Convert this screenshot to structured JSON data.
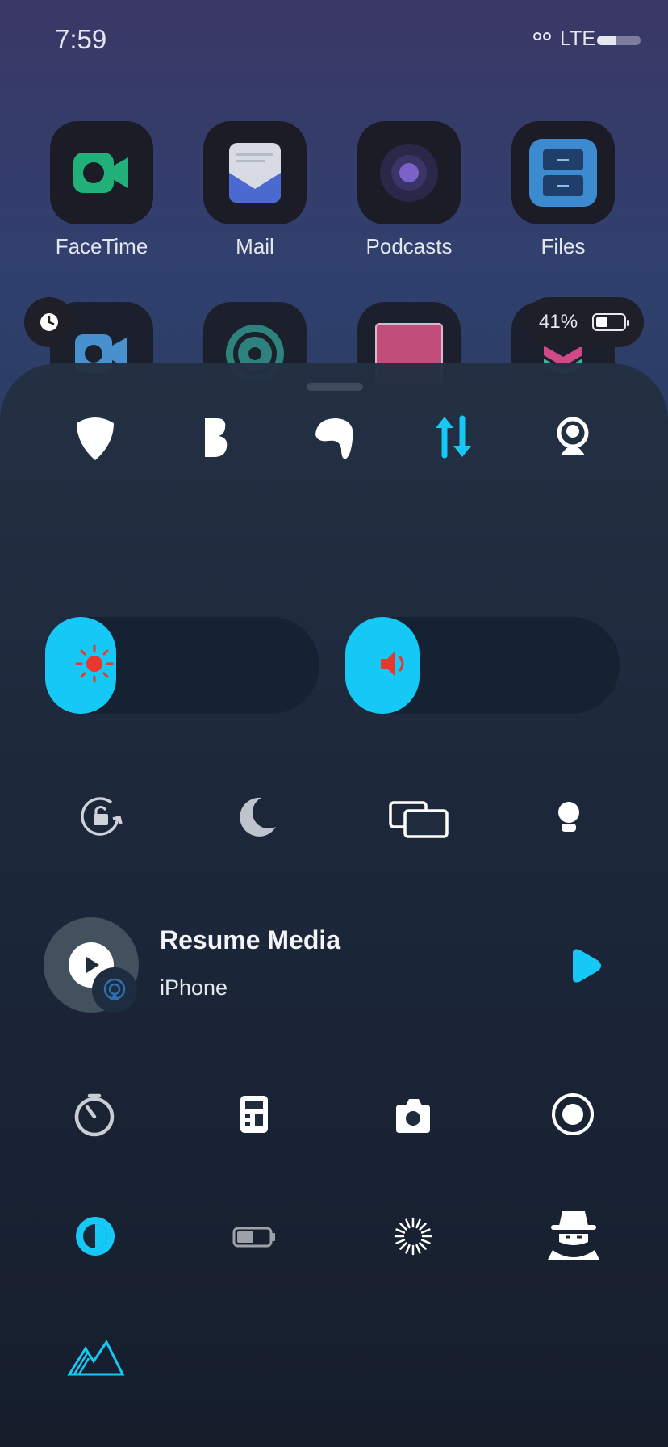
{
  "status_bar": {
    "time": "7:59",
    "network": "LTE",
    "battery_level": 0.45
  },
  "apps": [
    {
      "label": "FaceTime",
      "icon": "facetime-icon"
    },
    {
      "label": "Mail",
      "icon": "mail-icon"
    },
    {
      "label": "Podcasts",
      "icon": "podcasts-icon"
    },
    {
      "label": "Files",
      "icon": "files-icon"
    }
  ],
  "badges": {
    "battery_percent": "41%"
  },
  "control_center": {
    "toggles": [
      "guitar-pick-icon",
      "bold-b-icon",
      "bubble-icon",
      "data-arrows-icon",
      "personal-hotspot-icon"
    ],
    "active_color": "#16c8f6",
    "sliders": {
      "brightness_level": 0.26,
      "volume_level": 0.27
    },
    "row2_controls": [
      "rotation-lock-icon",
      "moon-icon",
      "screen-mirroring-icon",
      "flashlight-icon"
    ],
    "media": {
      "title": "Resume Media",
      "subtitle": "iPhone"
    },
    "row3_controls": [
      "timer-icon",
      "calculator-icon",
      "camera-icon",
      "screen-record-icon"
    ],
    "row4_controls": [
      "dark-mode-icon",
      "low-power-battery-icon",
      "loading-spinner-icon",
      "incognito-icon"
    ],
    "row5_controls": [
      "mountains-icon"
    ]
  }
}
